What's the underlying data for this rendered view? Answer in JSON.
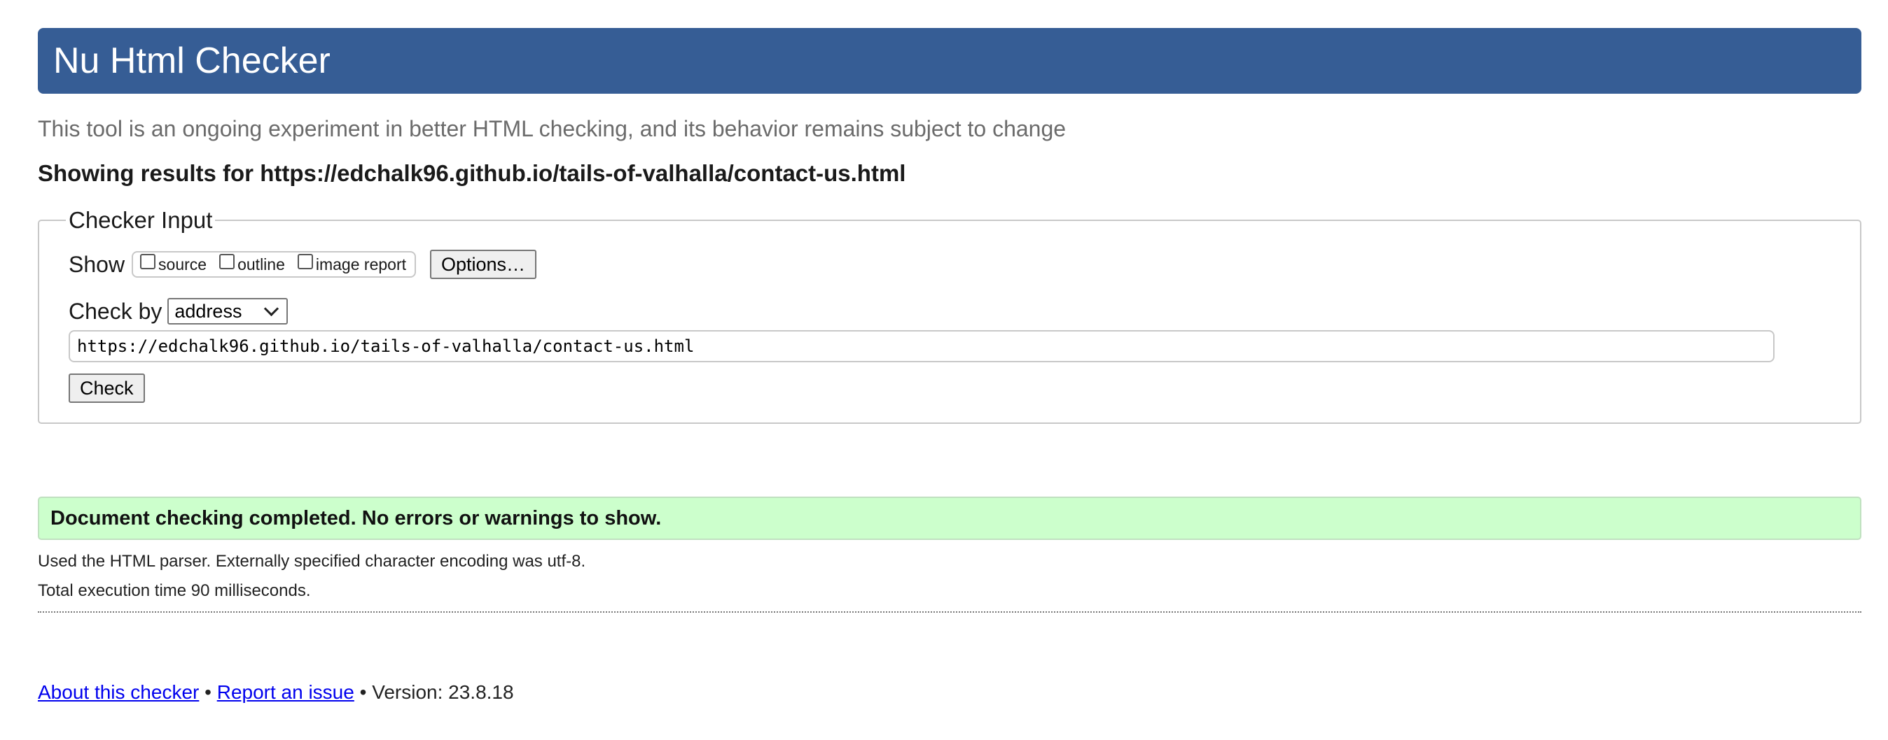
{
  "header": {
    "title": "Nu Html Checker"
  },
  "subtitle": "This tool is an ongoing experiment in better HTML checking, and its behavior remains subject to change",
  "results_for": "Showing results for https://edchalk96.github.io/tails-of-valhalla/contact-us.html",
  "checker_input": {
    "legend": "Checker Input",
    "show_label": "Show",
    "options": [
      {
        "label": "source",
        "checked": false
      },
      {
        "label": "outline",
        "checked": false
      },
      {
        "label": "image report",
        "checked": false
      }
    ],
    "options_button": "Options…",
    "check_by_label": "Check by",
    "check_by_value": "address",
    "url_value": "https://edchalk96.github.io/tails-of-valhalla/contact-us.html",
    "check_button": "Check"
  },
  "result": {
    "message": "Document checking completed. No errors or warnings to show.",
    "color": "#ccffcc"
  },
  "info": {
    "parser": "Used the HTML parser. Externally specified character encoding was utf-8.",
    "time": "Total execution time 90 milliseconds."
  },
  "footer": {
    "about_link": "About this checker",
    "separator": "•",
    "report_link": "Report an issue",
    "version": "Version: 23.8.18"
  },
  "colors": {
    "banner": "#365d95",
    "link": "#0000ee"
  },
  "icons": {
    "select_arrow": "chevron-down-icon"
  }
}
